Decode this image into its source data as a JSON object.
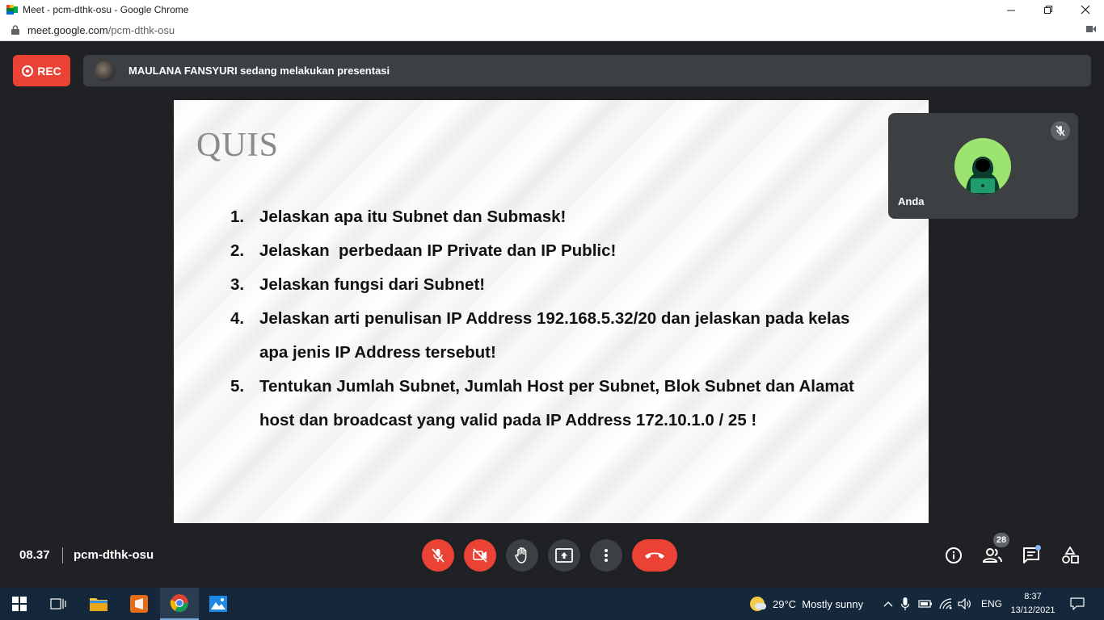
{
  "browser": {
    "window_title": "Meet - pcm-dthk-osu - Google Chrome",
    "url_host": "meet.google.com",
    "url_path": "/pcm-dthk-osu"
  },
  "meet": {
    "rec_label": "REC",
    "presenting_text": "MAULANA FANSYURI sedang melakukan presentasi",
    "self_name": "Anda",
    "time": "08.37",
    "meeting_code": "pcm-dthk-osu",
    "participants_count": "28"
  },
  "slide": {
    "title": "QUIS",
    "questions": [
      {
        "num": "1.",
        "text": "Jelaskan apa itu Subnet dan Submask!"
      },
      {
        "num": "2.",
        "text": "Jelaskan  perbedaan IP Private dan IP Public!"
      },
      {
        "num": "3.",
        "text": "Jelaskan fungsi dari Subnet!"
      },
      {
        "num": "4.",
        "text": "Jelaskan arti penulisan IP Address 192.168.5.32/20 dan jelaskan pada kelas apa jenis IP Address tersebut!"
      },
      {
        "num": "5.",
        "text": "Tentukan Jumlah Subnet, Jumlah Host per Subnet, Blok Subnet dan Alamat host dan broadcast yang valid pada IP Address 172.10.1.0 / 25 !"
      }
    ]
  },
  "taskbar": {
    "weather": "29°C  Mostly sunny",
    "language": "ENG",
    "clock_time": "8:37",
    "clock_date": "13/12/2021"
  },
  "colors": {
    "meet_bg": "#202124",
    "tile_bg": "#3c4043",
    "danger": "#ea4335",
    "taskbar": "#14273b"
  }
}
